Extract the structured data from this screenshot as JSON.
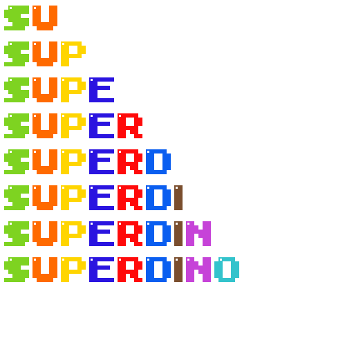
{
  "words": [
    "SU",
    "SUP",
    "SUPE",
    "SUPER",
    "SUPERD",
    "SUPERDI",
    "SUPERDIN",
    "SUPERDINO"
  ],
  "letter_colors": {
    "S": "#7ed321",
    "U": "#ff6a00",
    "P": "#ffd500",
    "E": "#2a14e0",
    "R": "#ff0a0a",
    "D": "#0a5ef0",
    "I": "#7a4e2e",
    "N": "#c643d8",
    "O": "#33c3cc"
  },
  "background": "#ffffff"
}
